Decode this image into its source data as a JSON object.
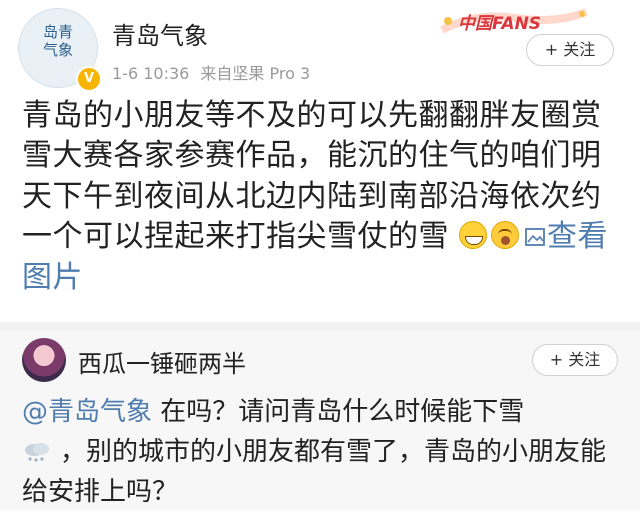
{
  "post": {
    "avatar_text_1": "岛",
    "avatar_text_2": "青",
    "avatar_text_3": "气",
    "avatar_text_4": "象",
    "verified_icon": "verified-v-icon",
    "author": "青岛气象",
    "time": "1-6 10:36",
    "source": "来自坚果 Pro 3",
    "fans_badge": "中国FANS",
    "follow_label": "+ 关注",
    "text": "青岛的小朋友等不及的可以先翻翻胖友圈赏雪大赛各家参赛作品，能沉的住气的咱们明天下午到夜间从北边内陆到南部沿海依次约一个可以捏起来打指尖雪仗的雪",
    "view_images_label": "查看图片"
  },
  "comment": {
    "author": "西瓜一锤砸两半",
    "follow_label": "+ 关注",
    "mention": "@青岛气象",
    "text_1": " 在吗？请问青岛什么时候能下雪",
    "text_2": "，别的城市的小朋友都有雪了，青岛的小朋友能给安排上吗？"
  },
  "colors": {
    "link": "#507daf",
    "verified": "#f7b500",
    "fans_red": "#d9363e",
    "muted": "#999999"
  }
}
